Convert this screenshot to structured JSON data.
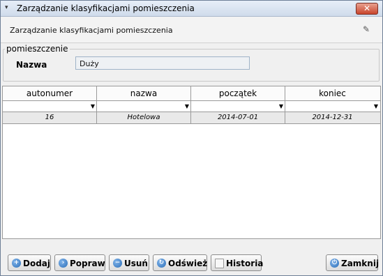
{
  "window": {
    "title": "Zarządzanie klasyfikacjami pomieszczenia",
    "close_label": "✕"
  },
  "header": {
    "title": "Zarządzanie klasyfikacjami pomieszczenia"
  },
  "form": {
    "group_label": "pomieszczenie",
    "name_label": "Nazwa",
    "name_value": "Duży"
  },
  "grid": {
    "columns": [
      "autonumer",
      "nazwa",
      "początek",
      "koniec"
    ],
    "rows": [
      [
        "16",
        "Hotelowa",
        "2014-07-01",
        "2014-12-31"
      ]
    ]
  },
  "buttons": {
    "add": "Dodaj",
    "edit": "Popraw",
    "delete": "Usuń",
    "refresh": "Odśwież",
    "history": "Historia",
    "close": "Zamknij"
  },
  "icons": {
    "title": "window-menu-icon",
    "header": "eraser-icon",
    "add": "plus-icon",
    "edit": "arrow-right-icon",
    "delete": "minus-icon",
    "refresh": "refresh-icon",
    "history": "document-icon",
    "close": "exit-icon"
  }
}
